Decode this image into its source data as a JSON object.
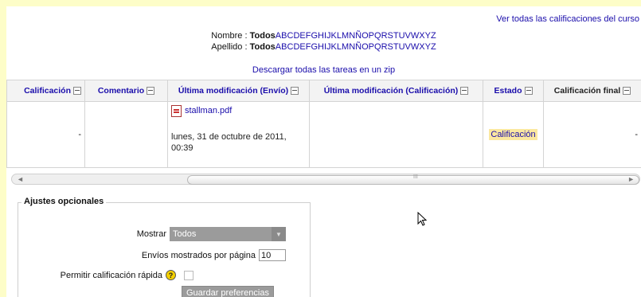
{
  "header": {
    "view_all_grades": "Ver todas las calificaciones del curso",
    "first_name_label": "Nombre :",
    "last_name_label": "Apellido :",
    "all_label": "Todos",
    "letters": [
      "A",
      "B",
      "C",
      "D",
      "E",
      "F",
      "G",
      "H",
      "I",
      "J",
      "K",
      "L",
      "M",
      "N",
      "Ñ",
      "O",
      "P",
      "Q",
      "R",
      "S",
      "T",
      "U",
      "V",
      "W",
      "X",
      "Y",
      "Z"
    ],
    "download_all": "Descargar todas las tareas en un zip"
  },
  "table": {
    "columns": [
      {
        "label": "Calificación"
      },
      {
        "label": "Comentario"
      },
      {
        "label": "Última modificación (Envío)"
      },
      {
        "label": "Última modificación (Calificación)"
      },
      {
        "label": "Estado"
      },
      {
        "label": "Calificación final"
      }
    ],
    "row": {
      "grade": "-",
      "comment": "",
      "file_name": "stallman.pdf",
      "submission_date": "lunes, 31 de octubre de 2011, 00:39",
      "grade_modified": "",
      "status": "Calificación",
      "final_grade": "-"
    }
  },
  "options": {
    "legend": "Ajustes opcionales",
    "show_label": "Mostrar",
    "show_value": "Todos",
    "per_page_label": "Envíos mostrados por página",
    "per_page_value": "10",
    "quick_grading_label": "Permitir calificación rápida",
    "help_glyph": "?",
    "save_button": "Guardar preferencias"
  },
  "scrollbar": {
    "left_arrow": "◄",
    "right_arrow": "►",
    "grip": "III"
  }
}
